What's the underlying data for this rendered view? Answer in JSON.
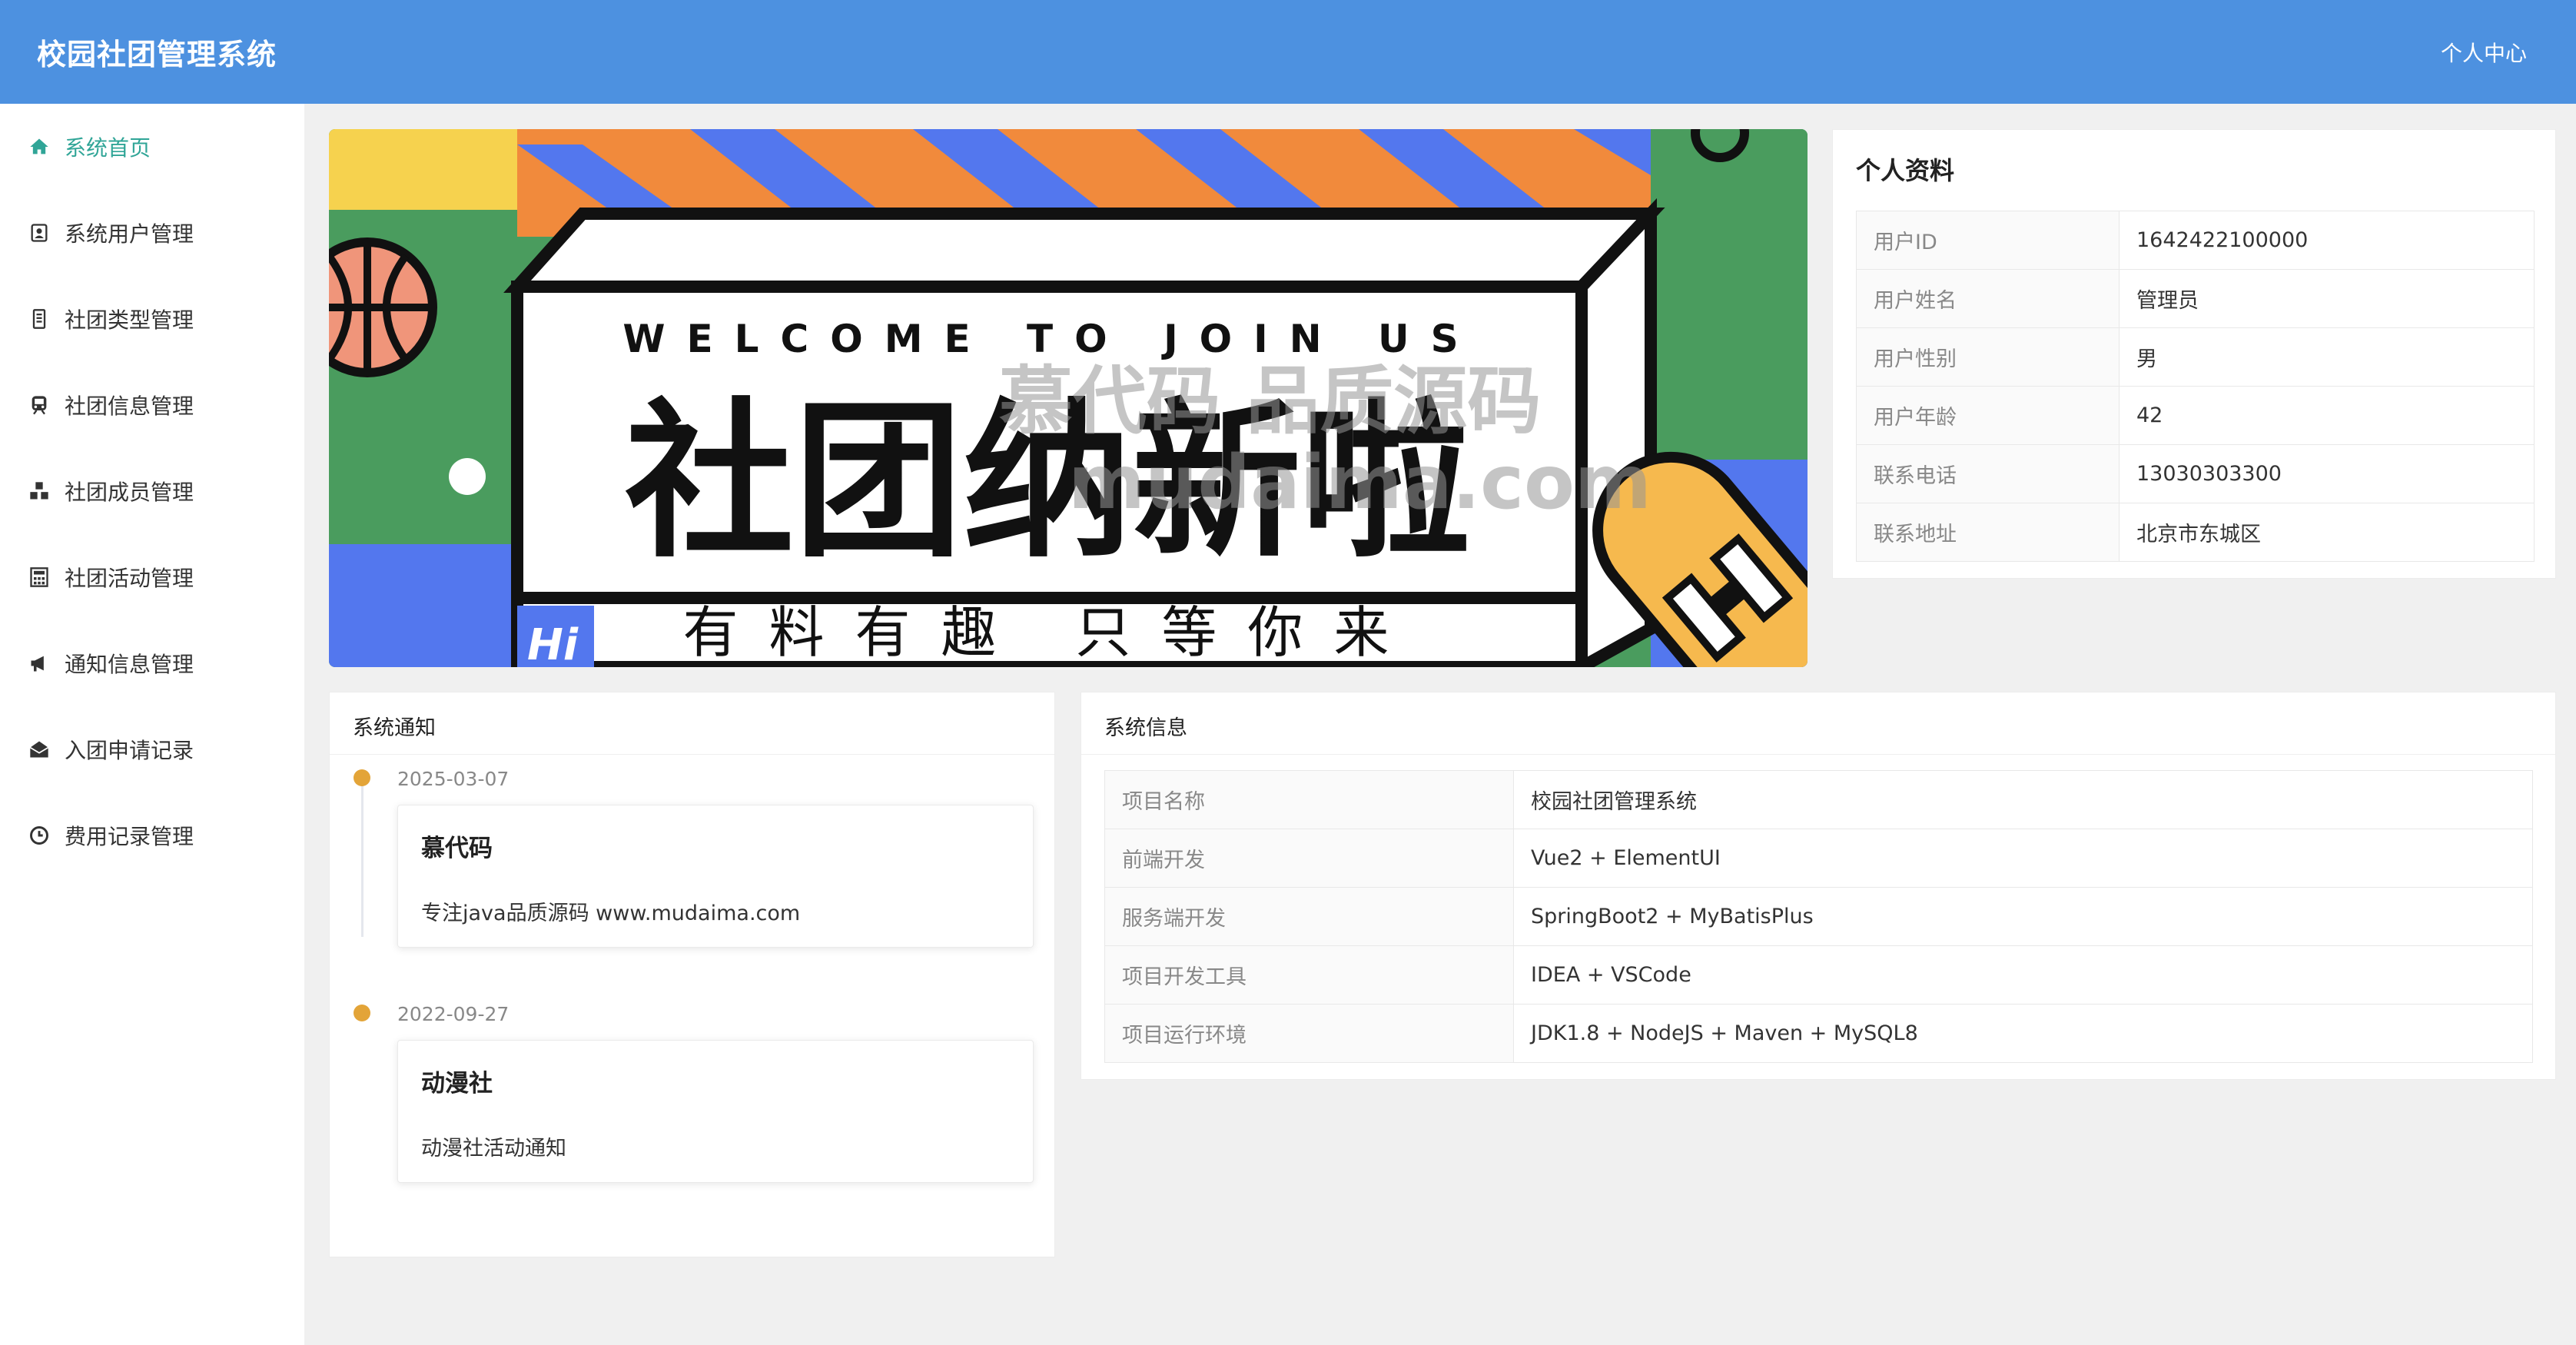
{
  "header": {
    "app_title": "校园社团管理系统",
    "user_center": "个人中心"
  },
  "sidebar": {
    "items": [
      {
        "label": "系统首页",
        "icon": "home-icon",
        "active": true
      },
      {
        "label": "系统用户管理",
        "icon": "user-card-icon",
        "active": false
      },
      {
        "label": "社团类型管理",
        "icon": "book-icon",
        "active": false
      },
      {
        "label": "社团信息管理",
        "icon": "train-icon",
        "active": false
      },
      {
        "label": "社团成员管理",
        "icon": "cubes-icon",
        "active": false
      },
      {
        "label": "社团活动管理",
        "icon": "calculator-icon",
        "active": false
      },
      {
        "label": "通知信息管理",
        "icon": "bullhorn-icon",
        "active": false
      },
      {
        "label": "入团申请记录",
        "icon": "envelope-open-icon",
        "active": false
      },
      {
        "label": "费用记录管理",
        "icon": "clock-icon",
        "active": false
      }
    ],
    "active_color": "#30a597"
  },
  "banner": {
    "headline_en": "WELCOME TO JOIN US",
    "headline_cn": "社团纳新啦",
    "subline_cn": "有料有趣  只等你来",
    "corner_text": "Hi"
  },
  "watermark": {
    "line1": "慕代码 品质源码",
    "line2": "mudaima.com"
  },
  "profile": {
    "title": "个人资料",
    "rows": [
      {
        "key": "用户ID",
        "value": "1642422100000"
      },
      {
        "key": "用户姓名",
        "value": "管理员"
      },
      {
        "key": "用户性别",
        "value": "男"
      },
      {
        "key": "用户年龄",
        "value": "42"
      },
      {
        "key": "联系电话",
        "value": "13030303300"
      },
      {
        "key": "联系地址",
        "value": "北京市东城区"
      }
    ]
  },
  "notices": {
    "title": "系统通知",
    "items": [
      {
        "date": "2025-03-07",
        "title": "慕代码",
        "desc": "专注java品质源码 www.mudaima.com"
      },
      {
        "date": "2022-09-27",
        "title": "动漫社",
        "desc": "动漫社活动通知"
      }
    ],
    "dot_color": "#e3a438"
  },
  "sysinfo": {
    "title": "系统信息",
    "rows": [
      {
        "key": "项目名称",
        "value": "校园社团管理系统"
      },
      {
        "key": "前端开发",
        "value": "Vue2 + ElementUI"
      },
      {
        "key": "服务端开发",
        "value": "SpringBoot2 + MyBatisPlus"
      },
      {
        "key": "项目开发工具",
        "value": "IDEA + VSCode"
      },
      {
        "key": "项目运行环境",
        "value": "JDK1.8 + NodeJS + Maven + MySQL8"
      }
    ]
  },
  "colors": {
    "header_bg": "#4d91e0",
    "page_bg": "#f0f0f0"
  }
}
